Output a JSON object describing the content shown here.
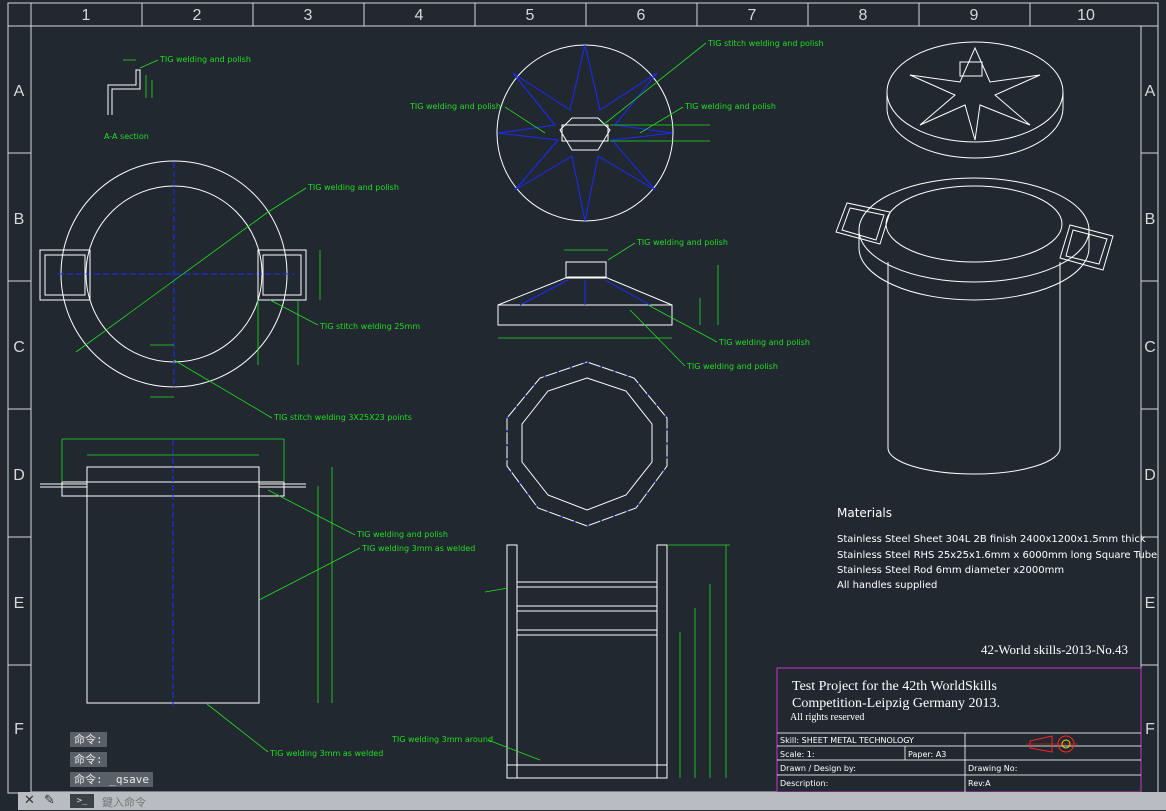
{
  "zones": {
    "top": [
      "1",
      "2",
      "3",
      "4",
      "5",
      "6",
      "7",
      "8",
      "9",
      "10"
    ],
    "side": [
      "A",
      "B",
      "C",
      "D",
      "E",
      "F"
    ]
  },
  "annotations": {
    "aa_weld": "TIG welding and polish",
    "aa_section": "A-A section",
    "top_weld_left": "TIG welding and polish",
    "top_weld_right": "TIG welding and polish",
    "top_stitch": "TIG stitch welding and polish",
    "plan_weld": "TIG welding and polish",
    "plan_stitch": "TIG stitch welding 25mm",
    "plan_stitch_points": "TIG stitch welding 3X25X23 points",
    "lid_weld_top": "TIG welding and polish",
    "lid_weld_right": "TIG welding and polish",
    "lid_weld_bottom": "TIG welding and polish",
    "elev_weld": "TIG welding and polish",
    "elev_weld_3mm": "TIG welding 3mm as welded",
    "elev_weld_bottom": "TIG welding 3mm as welded",
    "frame_weld": "TIG welding 3mm around"
  },
  "materials": {
    "heading": "Materials",
    "lines": [
      "Stainless Steel Sheet 304L 2B finish 2400x1200x1.5mm thick",
      "Stainless Steel RHS 25x25x1.6mm x 6000mm long Square Tube",
      "Stainless Steel Rod 6mm diameter x2000mm",
      "All handles supplied"
    ]
  },
  "drawing_id": "42-World skills-2013-No.43",
  "title_block": {
    "line1": "Test Project for the 42th WorldSkills",
    "line2": "Competition-Leipzig Germany 2013.",
    "rights": "All rights reserved",
    "skill": "Skill: SHEET METAL TECHNOLOGY",
    "scale": "Scale: 1:",
    "paper": "Paper: A3",
    "drawn": "Drawn / Design by:",
    "drawing_no": "Drawing No:",
    "description": "Description:",
    "rev": "Rev:A"
  },
  "command": {
    "history": [
      "命令:",
      "命令:",
      "命令: _qsave"
    ],
    "placeholder": "鍵入命令",
    "prompt_icon": ">_"
  }
}
